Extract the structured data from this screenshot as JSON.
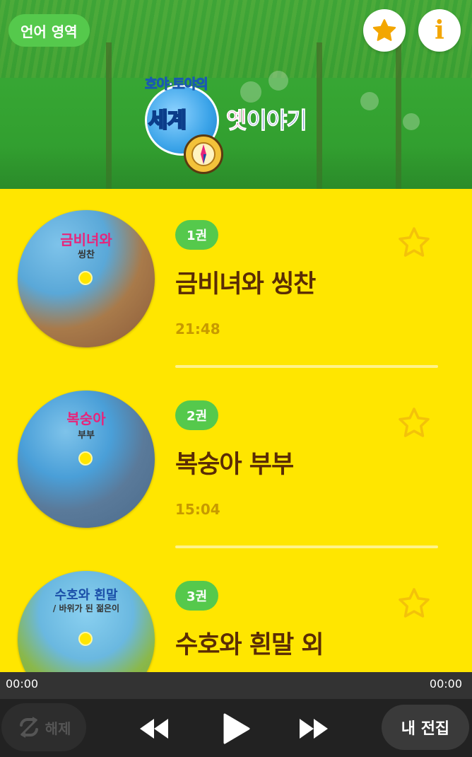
{
  "header": {
    "language_button": "언어 영역",
    "logo": {
      "top_text": "호야·토야의",
      "globe_text": "세계",
      "right_text_a": "옛",
      "right_text_b": "이야기"
    }
  },
  "items": [
    {
      "volume": "1권",
      "title": "금비녀와 씽찬",
      "duration": "21:48",
      "cover_title_line1": "금비녀와",
      "cover_title_line2": "씽찬",
      "cover_colors": {
        "top": "#5aa8d8",
        "bottom": "#8a5a3a",
        "title": "#E8247A"
      }
    },
    {
      "volume": "2권",
      "title": "복숭아 부부",
      "duration": "15:04",
      "cover_title_line1": "복숭아",
      "cover_title_line2": "부부",
      "cover_colors": {
        "top": "#4a9fd8",
        "bottom": "#4a6a8a",
        "title": "#E8247A"
      }
    },
    {
      "volume": "3권",
      "title": "수호와 흰말 외",
      "duration": "",
      "cover_title_line1": "수호와 흰말",
      "cover_title_line2": "/ 바위가 된 젊은이",
      "cover_colors": {
        "top": "#6ab8e0",
        "bottom": "#7aa83a",
        "title": "#1a4ea8"
      }
    }
  ],
  "player": {
    "current_time": "00:00",
    "total_time": "00:00",
    "loop_label": "해제",
    "my_collection_label": "내 전집"
  },
  "colors": {
    "background": "#FFE600",
    "accent_green": "#55C94C",
    "title_brown": "#5a2c05",
    "duration_gold": "#C79A00",
    "player_dark": "#222222"
  }
}
